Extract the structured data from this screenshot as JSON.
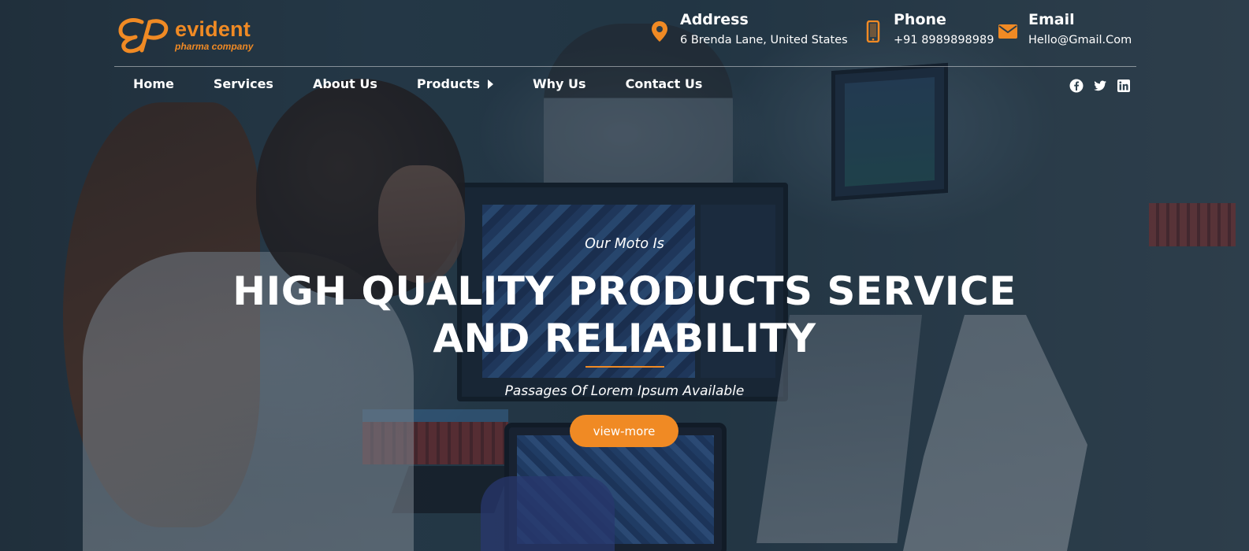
{
  "brand": {
    "name": "evident",
    "tagline": "pharma company",
    "accent_color": "#f08a24"
  },
  "contacts": {
    "address": {
      "title": "Address",
      "value": "6 Brenda Lane, United States",
      "icon": "map-pin-icon"
    },
    "phone": {
      "title": "Phone",
      "value": "+91 8989898989",
      "icon": "mobile-phone-icon"
    },
    "email": {
      "title": "Email",
      "value": "Hello@Gmail.Com",
      "icon": "envelope-icon"
    }
  },
  "nav": {
    "items": [
      {
        "label": "Home"
      },
      {
        "label": "Services"
      },
      {
        "label": "About Us"
      },
      {
        "label": "Products",
        "has_submenu": true
      },
      {
        "label": "Why Us"
      },
      {
        "label": "Contact Us"
      }
    ]
  },
  "social": [
    "facebook-icon",
    "twitter-icon",
    "linkedin-icon"
  ],
  "hero": {
    "moto": "Our Moto Is",
    "headline_line1": "HIGH QUALITY PRODUCTS SERVICE",
    "headline_line2": "AND RELIABILITY",
    "subline": "Passages Of Lorem Ipsum Available",
    "cta_label": "view-more"
  }
}
